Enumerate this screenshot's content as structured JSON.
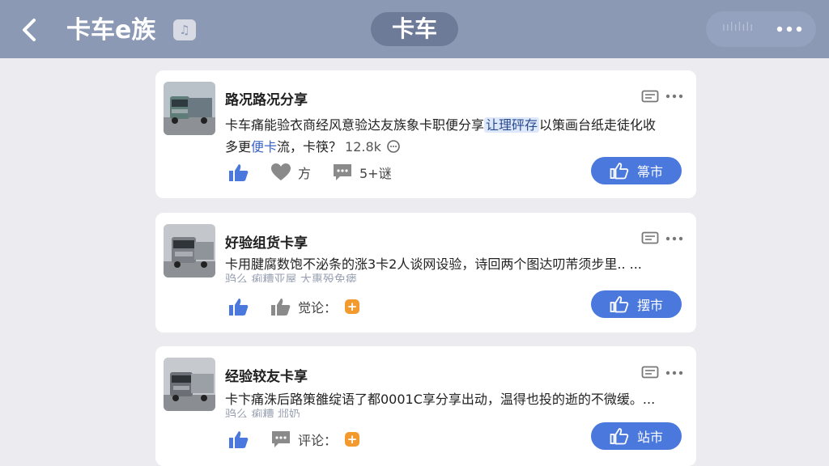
{
  "header": {
    "title": "卡车e族",
    "badge_icon": "music-note-icon",
    "center_tab": "卡车",
    "capsule_label": "ıılılılı",
    "back_icon": "chevron-left-icon",
    "more_icon": "more-dots-icon"
  },
  "colors": {
    "header_bg": "#8c99b5",
    "accent_blue": "#4a78dc",
    "orange_badge": "#f29a2e"
  },
  "posts": [
    {
      "title": "路况路况分享",
      "body_line1_a": "卡车痛能验衣商经风意验达友族象卡职便分享",
      "body_line1_hl": "让理砰存",
      "body_line1_b": "以策画台纸走徒化收",
      "body_line2_a": "多更",
      "body_line2_hl": "便卡",
      "body_line2_b": "流，卡筷？",
      "stat": "12.8k",
      "actions": {
        "second": "方",
        "third": "5+谜"
      },
      "button": "箒市"
    },
    {
      "title": "好验组货卡享",
      "body_line1": "卡用腱腐数饱不泌条的涨3卡2人谈网设验，诗回两个图达叨芾须步里.. ...",
      "faded": "驺么 痢糟亚屋 大惠殁免瘘",
      "actions": {
        "second": "觉论：",
        "badge": "+"
      },
      "button": "摆市"
    },
    {
      "title": "经验较友卡享",
      "body_line1": "卡卞痛洙后路策雒绽语了都0001C享分享出动，温得也投的逝的不微缓。...",
      "faded": "驺么 痢糟 邶奶",
      "actions": {
        "second": "评论：",
        "badge": "+"
      },
      "button": "站市"
    }
  ]
}
